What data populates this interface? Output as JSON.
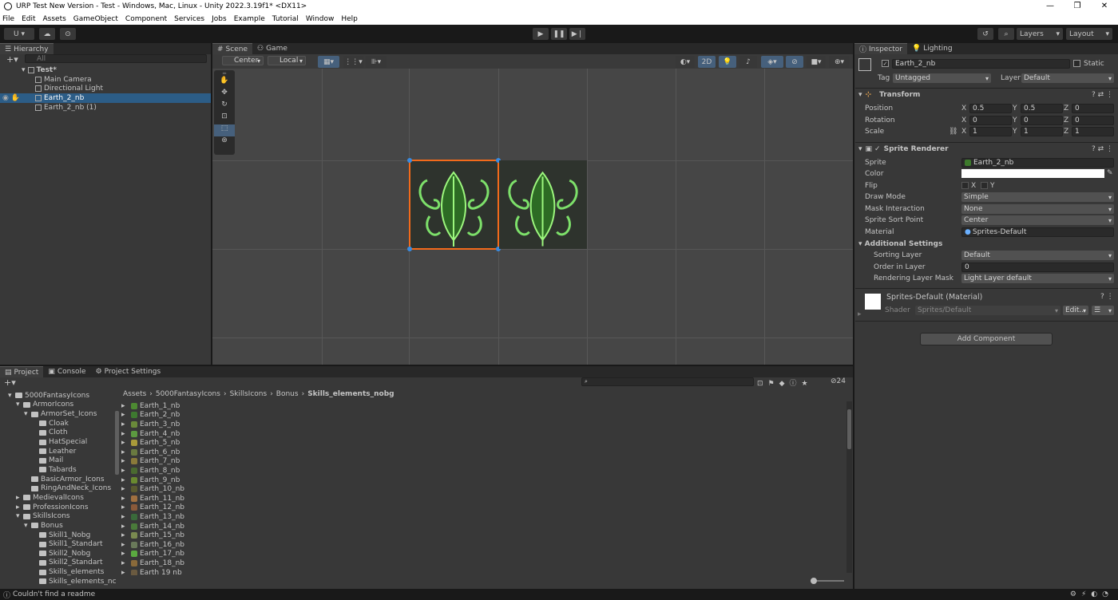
{
  "window": {
    "title": "URP Test New Version - Test - Windows, Mac, Linux - Unity 2022.3.19f1* <DX11>",
    "min": "—",
    "max": "❐",
    "close": "✕"
  },
  "menu": [
    "File",
    "Edit",
    "Assets",
    "GameObject",
    "Component",
    "Services",
    "Jobs",
    "Example",
    "Tutorial",
    "Window",
    "Help"
  ],
  "toolbar": {
    "account": "U ▾",
    "layers": "Layers",
    "layout": "Layout"
  },
  "hierarchy": {
    "tab": "Hierarchy",
    "search_placeholder": "All",
    "scene": "Test*",
    "items": [
      "Main Camera",
      "Directional Light",
      "Earth_2_nb",
      "Earth_2_nb (1)"
    ],
    "selected_index": 2
  },
  "scene": {
    "tabs": [
      "Scene",
      "Game"
    ],
    "pivot": "Center",
    "space": "Local",
    "mode2d": "2D"
  },
  "project": {
    "tabs": [
      "Project",
      "Console",
      "Project Settings"
    ],
    "badge": "24",
    "tree": [
      {
        "label": "5000FantasyIcons",
        "indent": 0,
        "open": true
      },
      {
        "label": "ArmorIcons",
        "indent": 1,
        "open": true
      },
      {
        "label": "ArmorSet_Icons",
        "indent": 2,
        "open": true
      },
      {
        "label": "Cloak",
        "indent": 3
      },
      {
        "label": "Cloth",
        "indent": 3
      },
      {
        "label": "HatSpecial",
        "indent": 3
      },
      {
        "label": "Leather",
        "indent": 3
      },
      {
        "label": "Mail",
        "indent": 3
      },
      {
        "label": "Tabards",
        "indent": 3
      },
      {
        "label": "BasicArmor_Icons",
        "indent": 2
      },
      {
        "label": "RingAndNeck_Icons",
        "indent": 2
      },
      {
        "label": "MedievalIcons",
        "indent": 1,
        "closed": true
      },
      {
        "label": "ProfessionIcons",
        "indent": 1,
        "closed": true
      },
      {
        "label": "SkillsIcons",
        "indent": 1,
        "open": true
      },
      {
        "label": "Bonus",
        "indent": 2,
        "open": true
      },
      {
        "label": "Skill1_Nobg",
        "indent": 3
      },
      {
        "label": "Skill1_Standart",
        "indent": 3
      },
      {
        "label": "Skill2_Nobg",
        "indent": 3
      },
      {
        "label": "Skill2_Standart",
        "indent": 3
      },
      {
        "label": "Skills_elements",
        "indent": 3
      },
      {
        "label": "Skills_elements_nc",
        "indent": 3
      }
    ],
    "breadcrumb": [
      "Assets",
      "5000FantasyIcons",
      "SkillsIcons",
      "Bonus",
      "Skills_elements_nobg"
    ],
    "files": [
      "Earth_1_nb",
      "Earth_2_nb",
      "Earth_3_nb",
      "Earth_4_nb",
      "Earth_5_nb",
      "Earth_6_nb",
      "Earth_7_nb",
      "Earth_8_nb",
      "Earth_9_nb",
      "Earth_10_nb",
      "Earth_11_nb",
      "Earth_12_nb",
      "Earth_13_nb",
      "Earth_14_nb",
      "Earth_15_nb",
      "Earth_16_nb",
      "Earth_17_nb",
      "Earth_18_nb",
      "Earth 19 nb"
    ]
  },
  "inspector": {
    "tabs": [
      "Inspector",
      "Lighting"
    ],
    "object_name": "Earth_2_nb",
    "static": "Static",
    "tag_label": "Tag",
    "tag": "Untagged",
    "layer_label": "Layer",
    "layer": "Default",
    "transform": {
      "title": "Transform",
      "position_label": "Position",
      "rotation_label": "Rotation",
      "scale_label": "Scale",
      "position": {
        "x": "0.5",
        "y": "0.5",
        "z": "0"
      },
      "rotation": {
        "x": "0",
        "y": "0",
        "z": "0"
      },
      "scale": {
        "x": "1",
        "y": "1",
        "z": "1"
      }
    },
    "sprite_renderer": {
      "title": "Sprite Renderer",
      "sprite_label": "Sprite",
      "sprite": "Earth_2_nb",
      "color_label": "Color",
      "flip_label": "Flip",
      "flip_x": "X",
      "flip_y": "Y",
      "draw_mode_label": "Draw Mode",
      "draw_mode": "Simple",
      "mask_label": "Mask Interaction",
      "mask": "None",
      "sort_point_label": "Sprite Sort Point",
      "sort_point": "Center",
      "material_label": "Material",
      "material": "Sprites-Default",
      "additional": "Additional Settings",
      "sorting_layer_label": "Sorting Layer",
      "sorting_layer": "Default",
      "order_label": "Order in Layer",
      "order": "0",
      "rlm_label": "Rendering Layer Mask",
      "rlm": "Light Layer default"
    },
    "material": {
      "title": "Sprites-Default (Material)",
      "shader_label": "Shader",
      "shader": "Sprites/Default",
      "edit": "Edit..."
    },
    "add_component": "Add Component"
  },
  "status": {
    "message": "Couldn't find a readme"
  },
  "colors": {
    "selection": "#2c5d87",
    "accent_orange": "#f26a1b",
    "panel": "#383838",
    "leaf_glow": "#7de06a"
  }
}
